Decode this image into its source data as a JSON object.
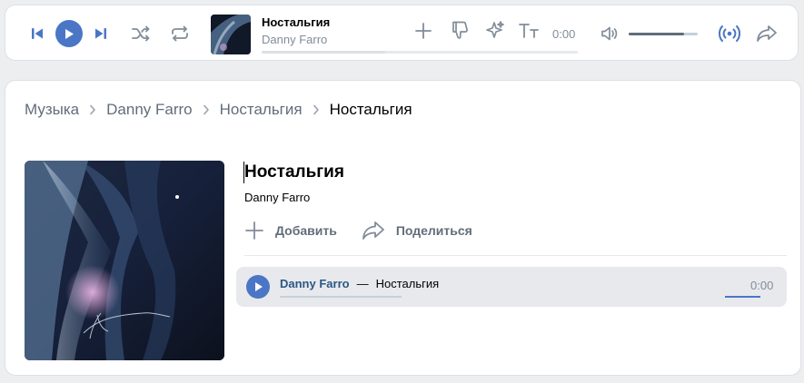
{
  "player": {
    "track_title": "Ностальгия",
    "track_artist": "Danny Farro",
    "time": "0:00",
    "progress": 0.39,
    "volume": 0.8,
    "icons": [
      "prev-icon",
      "play-icon",
      "next-icon",
      "shuffle-icon",
      "repeat-icon",
      "add-icon",
      "dislike-icon",
      "sparkle-icon",
      "lyrics-icon",
      "volume-icon",
      "broadcast-icon",
      "share-icon"
    ],
    "accent": "#4a76c5"
  },
  "breadcrumb": [
    "Музыка",
    "Danny Farro",
    "Ностальгия",
    "Ностальгия"
  ],
  "album": {
    "title": "Ностальгия",
    "artist": "Danny Farro",
    "add_label": "Добавить",
    "share_label": "Поделиться"
  },
  "track_row": {
    "artist": "Danny Farro",
    "dash": "—",
    "title": "Ностальгия",
    "time": "0:00"
  }
}
